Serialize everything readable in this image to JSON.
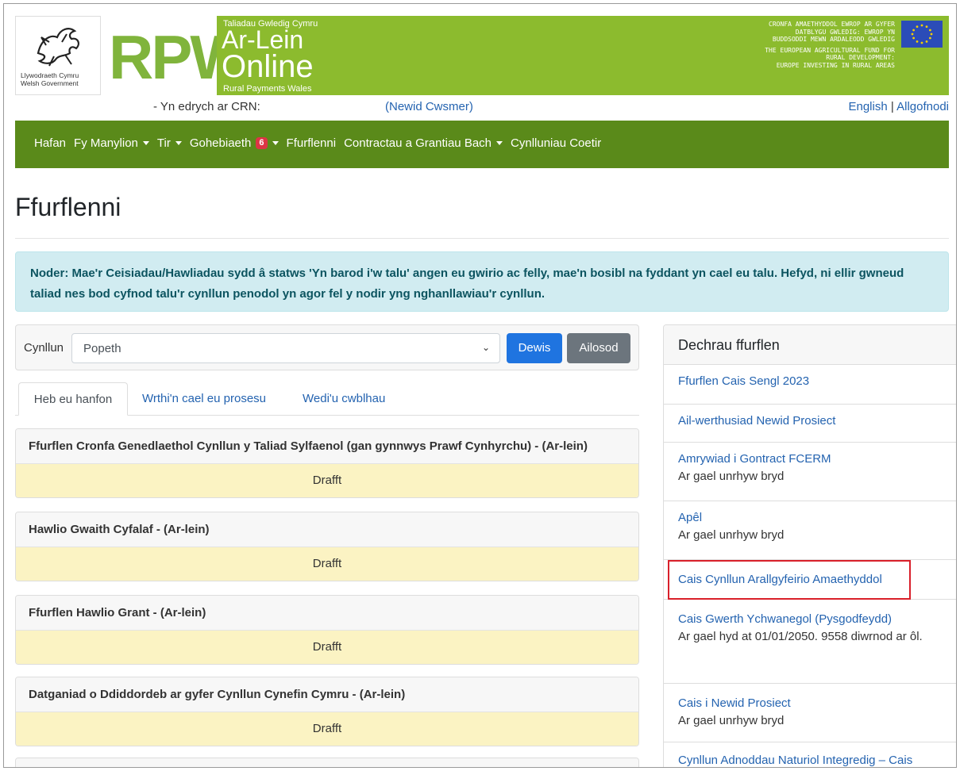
{
  "header": {
    "gov_name_line1": "Llywodraeth Cymru",
    "gov_name_line2": "Welsh Government",
    "logo_text": "RPW",
    "online_tagline": "Taliadau Gwledig Cymru",
    "online_line1": "Ar-Lein",
    "online_line2": "Online",
    "online_subtitle": "Rural Payments Wales",
    "eu_welsh": [
      "CRONFA AMAETHYDDOL EWROP AR GYFER",
      "DATBLYGU GWLEDIG: EWROP YN",
      "BUDDSODDI MEWN ARDALEODD GWLEDIG"
    ],
    "eu_english": [
      "THE EUROPEAN AGRICULTURAL FUND FOR",
      "RURAL DEVELOPMENT:",
      "EUROPE INVESTING IN RURAL AREAS"
    ]
  },
  "crn_bar": {
    "viewing_label": "- Yn edrych ar CRN:",
    "change_customer": "(Newid Cwsmer)",
    "lang_english": "English",
    "lang_separator": "|",
    "logout": "Allgofnodi"
  },
  "nav": {
    "items": [
      {
        "label": "Hafan",
        "dropdown": false
      },
      {
        "label": "Fy Manylion",
        "dropdown": true
      },
      {
        "label": "Tir",
        "dropdown": true
      },
      {
        "label": "Gohebiaeth",
        "dropdown": true,
        "badge": "6"
      },
      {
        "label": "Ffurflenni",
        "dropdown": false
      },
      {
        "label": "Contractau a Grantiau Bach",
        "dropdown": true
      },
      {
        "label": "Cynlluniau Coetir",
        "dropdown": false
      }
    ]
  },
  "page": {
    "title": "Ffurflenni",
    "alert": "Noder: Mae'r Ceisiadau/Hawliadau sydd â statws 'Yn barod i'w talu' angen eu gwirio ac felly, mae'n bosibl na fyddant yn cael eu talu. Hefyd, ni ellir gwneud taliad nes bod cyfnod talu'r cynllun penodol yn agor fel y nodir yng nghanllawiau'r cynllun."
  },
  "filter": {
    "label": "Cynllun",
    "selected": "Popeth",
    "select_button": "Dewis",
    "reset_button": "Ailosod"
  },
  "tabs": [
    {
      "label": "Heb eu hanfon",
      "active": true
    },
    {
      "label": "Wrthi'n cael eu prosesu",
      "active": false
    },
    {
      "label": "Wedi'u cwblhau",
      "active": false
    }
  ],
  "forms": [
    {
      "title": "Ffurflen Cronfa Genedlaethol Cynllun y Taliad Sylfaenol (gan gynnwys Prawf Cynhyrchu) - (Ar-lein)",
      "status": "Drafft"
    },
    {
      "title": "Hawlio Gwaith Cyfalaf - (Ar-lein)",
      "status": "Drafft"
    },
    {
      "title": "Ffurflen Hawlio Grant - (Ar-lein)",
      "status": "Drafft"
    },
    {
      "title": "Datganiad o Ddiddordeb ar gyfer Cynllun Cynefin Cymru - (Ar-lein)",
      "status": "Drafft"
    }
  ],
  "start_form": {
    "heading": "Dechrau ffurflen",
    "items": [
      {
        "label": "Ffurflen Cais Sengl 2023",
        "note": ""
      },
      {
        "label": "Ail-werthusiad Newid Prosiect",
        "note": ""
      },
      {
        "label": "Amrywiad i Gontract FCERM",
        "note": "Ar gael unrhyw bryd"
      },
      {
        "label": "Apêl",
        "note": "Ar gael unrhyw bryd"
      },
      {
        "label": "Cais Cynllun Arallgyfeirio Amaethyddol",
        "note": ""
      },
      {
        "label": "Cais Gwerth Ychwanegol (Pysgodfeydd)",
        "note": "Ar gael hyd at 01/01/2050. 9558 diwrnod ar ôl."
      },
      {
        "label": "Cais i Newid Prosiect",
        "note": "Ar gael unrhyw bryd"
      },
      {
        "label": "Cynllun Adnoddau Naturiol Integredig – Cais",
        "note": ""
      }
    ]
  },
  "colors": {
    "banner_green": "#8cbb2e",
    "nav_green": "#5a8a1a",
    "link_blue": "#2463b0",
    "draft_yellow": "#fbf3c3",
    "highlight_red": "#d9202a"
  }
}
